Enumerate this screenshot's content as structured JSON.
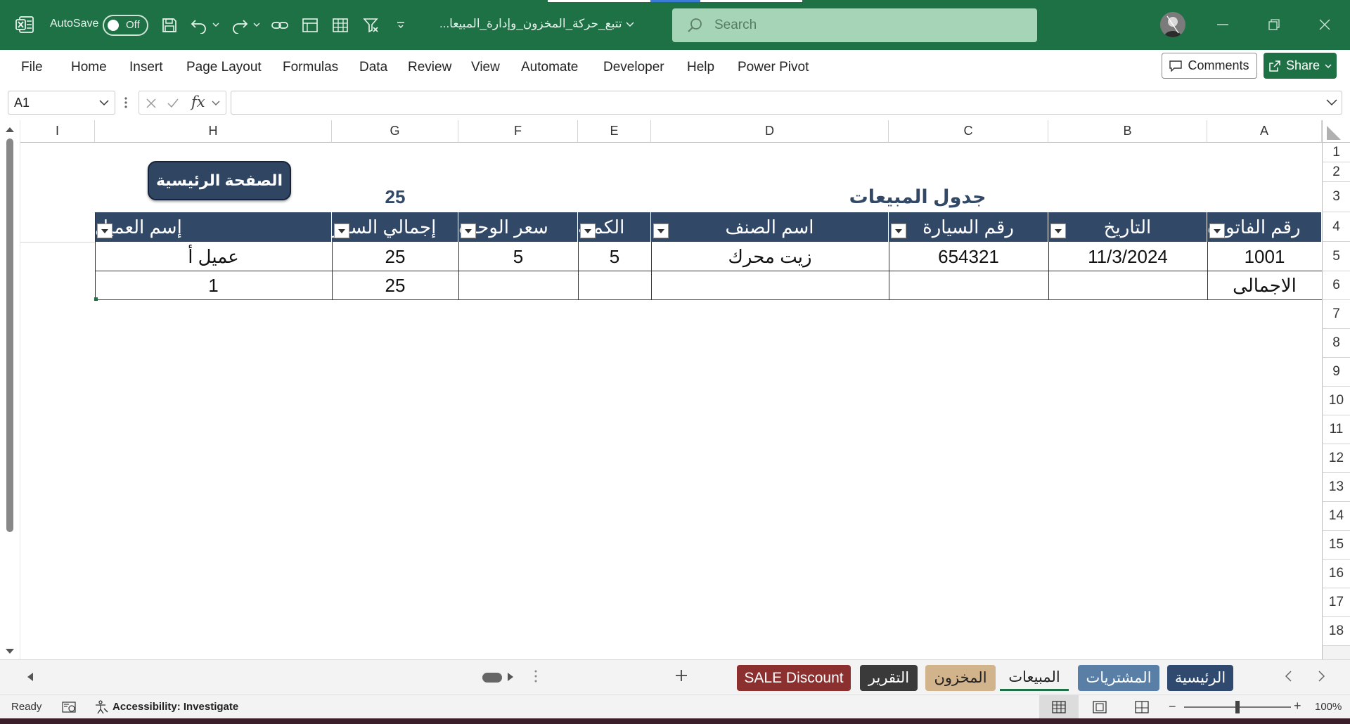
{
  "titlebar": {
    "autosave_label": "AutoSave",
    "autosave_state": "Off",
    "doc_title": "...تتبع_حركة_المخزون_وإدارة_المبيعا",
    "search_placeholder": "Search"
  },
  "menu": {
    "items": [
      "File",
      "Home",
      "Insert",
      "Page Layout",
      "Formulas",
      "Data",
      "Review",
      "View",
      "Automate",
      "Developer",
      "Help",
      "Power Pivot"
    ],
    "comments_label": "Comments",
    "share_label": "Share"
  },
  "formula_bar": {
    "name_box": "A1",
    "formula": ""
  },
  "columns": [
    "A",
    "B",
    "C",
    "D",
    "E",
    "F",
    "G",
    "H",
    "I"
  ],
  "rows": [
    "1",
    "2",
    "3",
    "4",
    "5",
    "6",
    "7",
    "8",
    "9",
    "10",
    "11",
    "12",
    "13",
    "14",
    "15",
    "16",
    "17",
    "18"
  ],
  "sheet": {
    "title": "جدول المبيعات",
    "g3_value": "25",
    "home_button": "الصفحة الرئيسية",
    "headers": {
      "A": "رقم الفاتورة",
      "B": "التاريخ",
      "C": "رقم السيارة",
      "D": "اسم الصنف",
      "E": "الكمية",
      "F": "سعر الوحدة",
      "G": "إجمالي السعر",
      "H": "إسم العميل"
    },
    "row5": {
      "A": "1001",
      "B": "11/3/2024",
      "C": "654321",
      "D": "زيت محرك",
      "E": "5",
      "F": "5",
      "G": "25",
      "H": "عميل أ"
    },
    "row6": {
      "A": "الاجمالى",
      "G": "25",
      "H": "1"
    }
  },
  "sheet_tabs": {
    "items": [
      "SALE Discount",
      "التقرير",
      "المخزون",
      "المبيعات",
      "المشتريات",
      "الرئيسية"
    ],
    "colors": [
      "#8b2f2f",
      "#3a3a3a",
      "#d2b48c",
      "transparent",
      "#5a7fa6",
      "#2f4a6e"
    ],
    "active": "المبيعات"
  },
  "status": {
    "ready": "Ready",
    "accessibility": "Accessibility: Investigate",
    "zoom": "100%"
  }
}
